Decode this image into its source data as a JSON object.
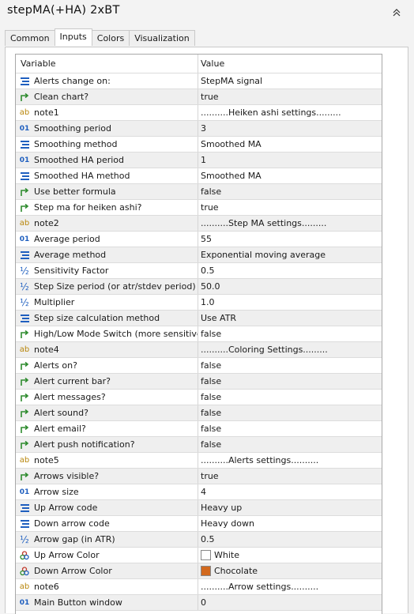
{
  "window": {
    "title": "stepMA(+HA) 2xBT"
  },
  "tabs": [
    {
      "label": "Common",
      "active": false
    },
    {
      "label": "Inputs",
      "active": true
    },
    {
      "label": "Colors",
      "active": false
    },
    {
      "label": "Visualization",
      "active": false
    }
  ],
  "grid": {
    "headers": {
      "variable": "Variable",
      "value": "Value"
    },
    "rows": [
      {
        "icon": "enum-icon",
        "name": "Alerts change on:",
        "value": "StepMA signal"
      },
      {
        "icon": "bool-icon",
        "name": "Clean chart?",
        "value": "true"
      },
      {
        "icon": "string-icon",
        "name": "note1",
        "value": "..........Heiken ashi settings........."
      },
      {
        "icon": "int-icon",
        "name": "Smoothing period",
        "value": "3"
      },
      {
        "icon": "enum-icon",
        "name": "Smoothing method",
        "value": "Smoothed MA"
      },
      {
        "icon": "int-icon",
        "name": "Smoothed HA period",
        "value": "1"
      },
      {
        "icon": "enum-icon",
        "name": "Smoothed HA method",
        "value": "Smoothed MA"
      },
      {
        "icon": "bool-icon",
        "name": "Use better formula",
        "value": "false"
      },
      {
        "icon": "bool-icon",
        "name": "Step ma for heiken ashi?",
        "value": "true"
      },
      {
        "icon": "string-icon",
        "name": "note2",
        "value": "..........Step MA settings........."
      },
      {
        "icon": "int-icon",
        "name": "Average period",
        "value": "55"
      },
      {
        "icon": "enum-icon",
        "name": "Average method",
        "value": "Exponential moving average"
      },
      {
        "icon": "double-icon",
        "name": "Sensitivity Factor",
        "value": "0.5"
      },
      {
        "icon": "double-icon",
        "name": "Step Size period (or atr/stdev period)",
        "value": "50.0"
      },
      {
        "icon": "double-icon",
        "name": "Multiplier",
        "value": "1.0"
      },
      {
        "icon": "enum-icon",
        "name": "Step size calculation method",
        "value": "Use ATR"
      },
      {
        "icon": "bool-icon",
        "name": "High/Low Mode Switch (more sensitive)",
        "value": "false"
      },
      {
        "icon": "string-icon",
        "name": "note4",
        "value": "..........Coloring Settings........."
      },
      {
        "icon": "bool-icon",
        "name": "Alerts on?",
        "value": "false"
      },
      {
        "icon": "bool-icon",
        "name": "Alert current bar?",
        "value": "false"
      },
      {
        "icon": "bool-icon",
        "name": "Alert messages?",
        "value": "false"
      },
      {
        "icon": "bool-icon",
        "name": "Alert sound?",
        "value": "false"
      },
      {
        "icon": "bool-icon",
        "name": "Alert email?",
        "value": "false"
      },
      {
        "icon": "bool-icon",
        "name": "Alert push notification?",
        "value": "false"
      },
      {
        "icon": "string-icon",
        "name": "note5",
        "value": "..........Alerts settings.........."
      },
      {
        "icon": "bool-icon",
        "name": "Arrows visible?",
        "value": "true"
      },
      {
        "icon": "int-icon",
        "name": "Arrow size",
        "value": "4"
      },
      {
        "icon": "enum-icon",
        "name": "Up Arrow code",
        "value": "Heavy up"
      },
      {
        "icon": "enum-icon",
        "name": "Down arrow code",
        "value": "Heavy down"
      },
      {
        "icon": "double-icon",
        "name": "Arrow gap (in ATR)",
        "value": "0.5"
      },
      {
        "icon": "color-icon",
        "name": "Up Arrow Color",
        "value": "White",
        "swatch": "#ffffff"
      },
      {
        "icon": "color-icon",
        "name": "Down Arrow Color",
        "value": "Chocolate",
        "swatch": "#d2691e"
      },
      {
        "icon": "string-icon",
        "name": "note6",
        "value": "..........Arrow settings.........."
      },
      {
        "icon": "int-icon",
        "name": "Main Button window",
        "value": "0"
      }
    ]
  },
  "colors": {
    "accent": "#1f5fbf",
    "bool_icon": "#2e8b2e",
    "string_icon": "#b8860b",
    "row_alt": "#efefef"
  }
}
